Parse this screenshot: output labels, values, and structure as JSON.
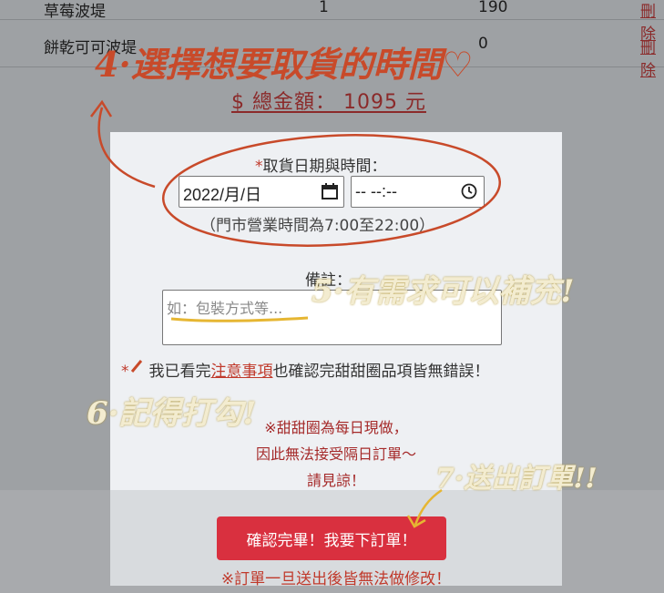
{
  "cart": {
    "rows": [
      {
        "name": "草莓波堤",
        "qty": "1",
        "price": "190",
        "delete": "刪除"
      },
      {
        "name": "餅乾可可波堤",
        "qty": "",
        "price": "0",
        "delete": "刪除"
      }
    ],
    "total": "$ 總金額： 1095 元"
  },
  "form": {
    "required_mark": "*",
    "pickup_label": "取貨日期與時間：",
    "date_value": "2022/月/日",
    "time_value": "-- --:--",
    "hours_note": "（門市營業時間為7:00至22:00）",
    "note_label": "備註：",
    "note_placeholder": "如：包裝方式等...",
    "confirm_prefix": "我已看完",
    "confirm_link": "注意事項",
    "confirm_suffix": "也確認完甜甜圈品項皆無錯誤！",
    "warn_lines": [
      "※甜甜圈為每日現做，",
      "因此無法接受隔日訂單～",
      "請見諒！"
    ],
    "submit_label": "確認完畢！我要下訂單！",
    "final_warning": "※訂單一旦送出後皆無法做修改！"
  },
  "annotations": {
    "step4": "4·選擇想要取貨的時間♡",
    "step5": "5·有需求可以補充!",
    "step6": "6·記得打勾!",
    "step7": "7·送出訂單!!"
  },
  "colors": {
    "submit": "#d9303f",
    "handwriting_red": "#c84a2a",
    "handwriting_yellow": "#f3ecd0",
    "link_red": "#c0392b"
  }
}
